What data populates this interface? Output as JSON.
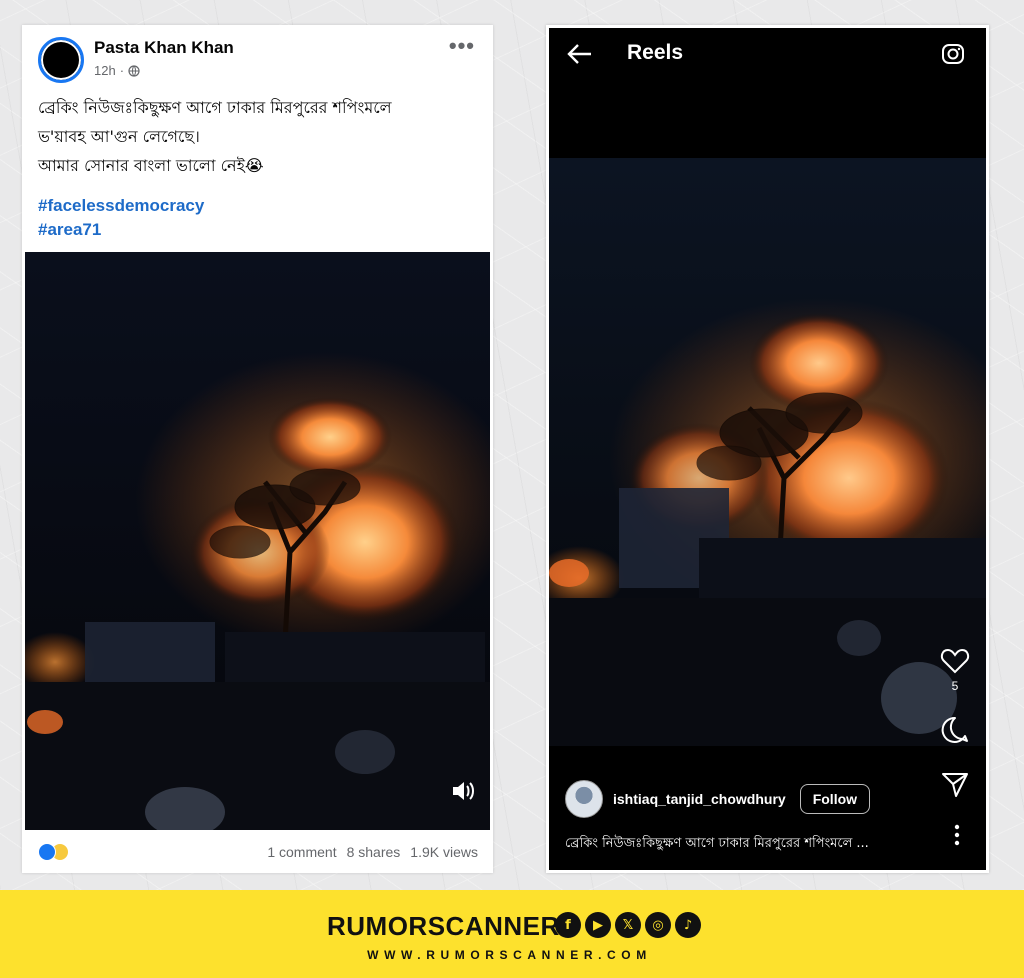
{
  "facebook_post": {
    "author": "Pasta Khan Khan",
    "time": "12h",
    "more_icon": "ellipsis-icon",
    "text_lines": [
      "ব্রেকিং নিউজঃকিছুক্ষণ আগে ঢাকার মিরপুরের শপিংমলে",
      "ভ'য়াবহ আ'গুন লেগেছে।",
      "আমার সোনার বাংলা ভালো নেই😭"
    ],
    "hashtags": [
      "#facelessdemocracy",
      "#area71"
    ],
    "reactions": [
      "like",
      "sad"
    ],
    "comments": "1 comment",
    "shares": "8 shares",
    "views": "1.9K views"
  },
  "instagram_reel": {
    "title": "Reels",
    "likes": "5",
    "username": "ishtiaq_tanjid_chowdhury",
    "follow_label": "Follow",
    "caption": "ব্রেকিং নিউজঃকিছুক্ষণ আগে ঢাকার মিরপুরের শপিংমলে ..."
  },
  "banner": {
    "brand": "RUMORSCANNER",
    "website": "WWW.RUMORSCANNER.COM",
    "social_icons": [
      "facebook-icon",
      "youtube-icon",
      "x-icon",
      "instagram-icon",
      "tiktok-icon"
    ],
    "color": "#fde12d"
  }
}
